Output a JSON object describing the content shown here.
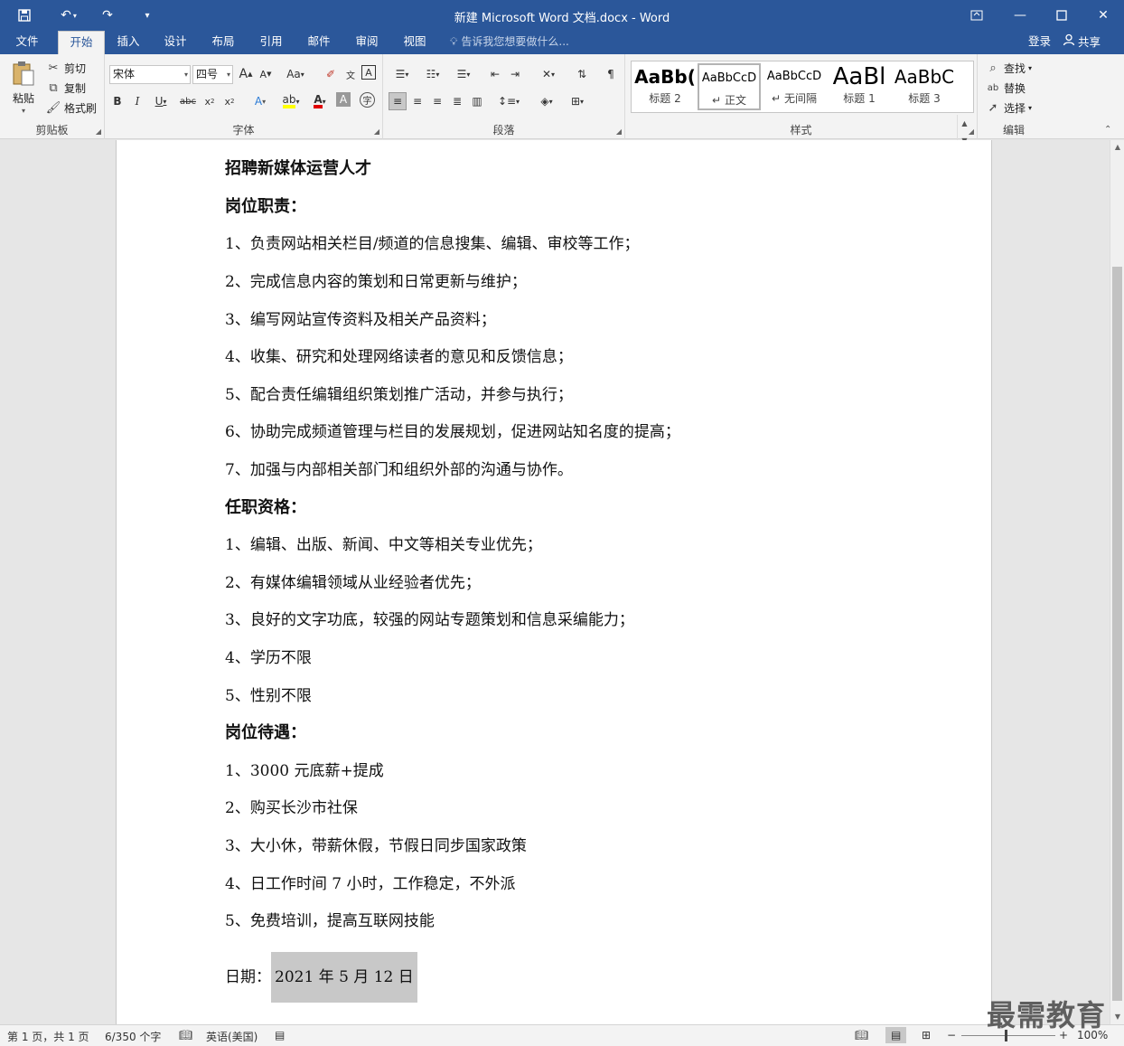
{
  "titlebar": {
    "title": "新建 Microsoft Word 文档.docx - Word",
    "icons": [
      "save-icon",
      "undo-icon",
      "redo-icon",
      "customize-qat-icon",
      "ribbon-display-options-icon",
      "minimize-icon",
      "maximize-icon",
      "close-icon"
    ]
  },
  "tabs": {
    "items": [
      "文件",
      "开始",
      "插入",
      "设计",
      "布局",
      "引用",
      "邮件",
      "审阅",
      "视图"
    ],
    "active": "开始",
    "tell_me": "告诉我您想要做什么...",
    "sign_in": "登录",
    "share": "共享"
  },
  "ribbon": {
    "clipboard": {
      "label": "剪贴板",
      "paste": "粘贴",
      "cut": "剪切",
      "copy": "复制",
      "format_painter": "格式刷"
    },
    "font": {
      "label": "字体",
      "font_name": "宋体",
      "font_size": "四号",
      "change_case": "Aa"
    },
    "paragraph": {
      "label": "段落"
    },
    "styles": {
      "label": "样式",
      "items": [
        {
          "sample": "AaBb(",
          "name": "标题 2"
        },
        {
          "sample": "AaBbCcD",
          "name": "正文",
          "mark": "↵"
        },
        {
          "sample": "AaBbCcD",
          "name": "无间隔",
          "mark": "↵"
        },
        {
          "sample": "AaBl",
          "name": "标题 1"
        },
        {
          "sample": "AaBbC",
          "name": "标题 3"
        }
      ]
    },
    "editing": {
      "label": "编辑",
      "find": "查找",
      "replace": "替换",
      "select": "选择"
    }
  },
  "document": {
    "paragraphs": [
      {
        "text": "招聘新媒体运营人才",
        "bold": true
      },
      {
        "text": "岗位职责：",
        "bold": true
      },
      {
        "text": "1、负责网站相关栏目/频道的信息搜集、编辑、审校等工作；"
      },
      {
        "text": "2、完成信息内容的策划和日常更新与维护；"
      },
      {
        "text": "3、编写网站宣传资料及相关产品资料；"
      },
      {
        "text": "4、收集、研究和处理网络读者的意见和反馈信息；"
      },
      {
        "text": "5、配合责任编辑组织策划推广活动，并参与执行；"
      },
      {
        "text": "6、协助完成频道管理与栏目的发展规划，促进网站知名度的提高；"
      },
      {
        "text": "7、加强与内部相关部门和组织外部的沟通与协作。"
      },
      {
        "text": "任职资格：",
        "bold": true
      },
      {
        "text": "1、编辑、出版、新闻、中文等相关专业优先；"
      },
      {
        "text": "2、有媒体编辑领域从业经验者优先；"
      },
      {
        "text": "3、良好的文字功底，较强的网站专题策划和信息采编能力；"
      },
      {
        "text": "4、学历不限"
      },
      {
        "text": "5、性别不限"
      },
      {
        "text": "岗位待遇：",
        "bold": true
      },
      {
        "text": "1、3000 元底薪+提成"
      },
      {
        "text": "2、购买长沙市社保"
      },
      {
        "text": "3、大小休，带薪休假，节假日同步国家政策"
      },
      {
        "text": "4、日工作时间 7 小时，工作稳定，不外派"
      },
      {
        "text": "5、免费培训，提高互联网技能"
      }
    ],
    "date_label": "日期：",
    "date_value": "2021 年 5 月 12 日"
  },
  "statusbar": {
    "page": "第 1 页，共 1 页",
    "words": "6/350 个字",
    "language": "英语(美国)",
    "zoom": "100%"
  },
  "watermark": "最需教育",
  "colors": {
    "accent": "#2b579a",
    "ribbon_bg": "#f3f3f3",
    "doc_bg": "#e6e6e6",
    "highlight": "#c8c8c8",
    "font_color_red": "#e00000",
    "highlight_yellow": "#ffff00"
  }
}
